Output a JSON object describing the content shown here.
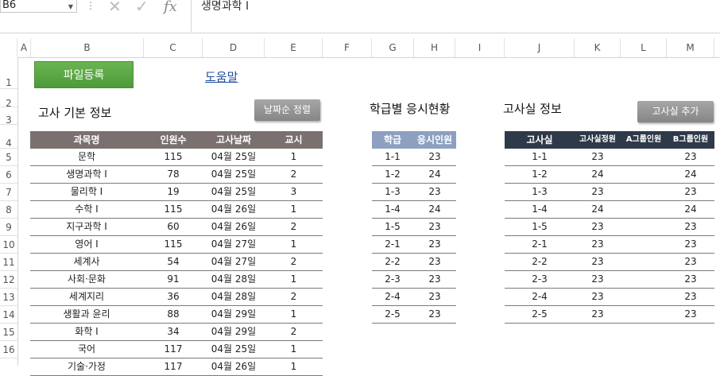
{
  "formula_bar": {
    "cell_ref": "B6",
    "content": "생명과학 I"
  },
  "columns": [
    "A",
    "B",
    "C",
    "D",
    "E",
    "F",
    "G",
    "H",
    "I",
    "J",
    "K",
    "L",
    "M"
  ],
  "rows": [
    "1",
    "2",
    "3",
    "4",
    "5",
    "6",
    "7",
    "8",
    "9",
    "10",
    "11",
    "12",
    "13",
    "14",
    "15",
    "16"
  ],
  "buttons": {
    "register": "파일등록",
    "help": "도움말",
    "sort_date": "날짜순 정렬",
    "add_room": "고사실 추가"
  },
  "titles": {
    "exam_info": "고사 기본 정보",
    "class_status": "학급별 응시현황",
    "room_info": "고사실 정보"
  },
  "exam_table": {
    "headers": [
      "과목명",
      "인원수",
      "고사날짜",
      "교시"
    ],
    "rows": [
      [
        "문학",
        "115",
        "04월 25일",
        "1"
      ],
      [
        "생명과학 I",
        "78",
        "04월 25일",
        "2"
      ],
      [
        "물리학 I",
        "19",
        "04월 25일",
        "3"
      ],
      [
        "수학 I",
        "115",
        "04월 26일",
        "1"
      ],
      [
        "지구과학 I",
        "60",
        "04월 26일",
        "2"
      ],
      [
        "영어 I",
        "115",
        "04월 27일",
        "1"
      ],
      [
        "세계사",
        "54",
        "04월 27일",
        "2"
      ],
      [
        "사회·문화",
        "91",
        "04월 28일",
        "1"
      ],
      [
        "세계지리",
        "36",
        "04월 28일",
        "2"
      ],
      [
        "생활과 윤리",
        "88",
        "04월 29일",
        "1"
      ],
      [
        "화학 I",
        "34",
        "04월 29일",
        "2"
      ],
      [
        "국어",
        "117",
        "04월 25일",
        "1"
      ],
      [
        "기술·가정",
        "117",
        "04월 26일",
        "1"
      ]
    ]
  },
  "class_table": {
    "headers": [
      "학급",
      "응시인원"
    ],
    "rows": [
      [
        "1-1",
        "23"
      ],
      [
        "1-2",
        "24"
      ],
      [
        "1-3",
        "23"
      ],
      [
        "1-4",
        "24"
      ],
      [
        "1-5",
        "23"
      ],
      [
        "2-1",
        "23"
      ],
      [
        "2-2",
        "23"
      ],
      [
        "2-3",
        "23"
      ],
      [
        "2-4",
        "23"
      ],
      [
        "2-5",
        "23"
      ]
    ]
  },
  "room_table": {
    "headers": [
      "고사실",
      "고사실정원",
      "A그룹인원",
      "B그룹인원"
    ],
    "rows": [
      [
        "1-1",
        "23",
        "",
        "23"
      ],
      [
        "1-2",
        "24",
        "",
        "24"
      ],
      [
        "1-3",
        "23",
        "",
        "23"
      ],
      [
        "1-4",
        "24",
        "",
        "24"
      ],
      [
        "1-5",
        "23",
        "",
        "23"
      ],
      [
        "2-1",
        "23",
        "",
        "23"
      ],
      [
        "2-2",
        "23",
        "",
        "23"
      ],
      [
        "2-3",
        "23",
        "",
        "23"
      ],
      [
        "2-4",
        "23",
        "",
        "23"
      ],
      [
        "2-5",
        "23",
        "",
        "23"
      ]
    ]
  },
  "colors": {
    "exam_header": "#7b7070",
    "class_header": "#8da0c0",
    "room_header": "#2e3949",
    "green_button": "#5ca844"
  }
}
